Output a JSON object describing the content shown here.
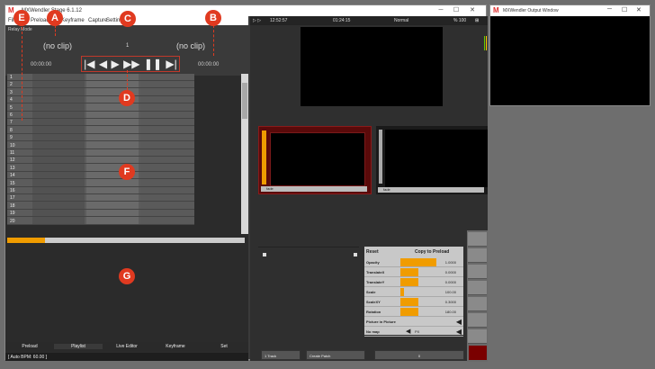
{
  "main_window": {
    "title": "MXWendler Stage 6.1.12"
  },
  "menu": [
    "File",
    "Preload",
    "Keyframe",
    "Capture",
    "Settings"
  ],
  "left": {
    "mode_label": "Relay Mode",
    "clip_left": "(no clip)",
    "clip_number": "1",
    "clip_right": "(no clip)",
    "time_left": "00:00:00",
    "time_right": "00:00:00",
    "transport": [
      "|◀",
      "◀",
      "▶",
      "▶▶",
      "❚❚",
      "▶|"
    ],
    "rows": [
      "1",
      "2",
      "3",
      "4",
      "5",
      "6",
      "7",
      "8",
      "9",
      "10",
      "11",
      "12",
      "13",
      "14",
      "15",
      "16",
      "17",
      "18",
      "19",
      "20"
    ],
    "tabs": [
      "Preload",
      "Playlist",
      "Live Editor",
      "Keyframe",
      "Set"
    ],
    "status": "[ Auto BPM: 60.00 ]"
  },
  "right": {
    "time_current": "12:52:57",
    "time_elapsed": "01:24:15",
    "blend_mode": "Normal",
    "opacity_pct": "% 100",
    "layer1_label": "fade",
    "layer2_label": "fade",
    "props": {
      "reset": "Reset",
      "copy": "Copy to Preload",
      "rows": [
        {
          "label": "Opacity",
          "value": "1.0000",
          "fill": 1.0
        },
        {
          "label": "TranslateX",
          "value": "0.0000",
          "fill": 0.5
        },
        {
          "label": "TranslateY",
          "value": "0.0000",
          "fill": 0.5
        },
        {
          "label": "Scale",
          "value": "100.00",
          "fill": 0.1
        },
        {
          "label": "ScaleXY",
          "value": "0.3000",
          "fill": 0.5
        },
        {
          "label": "Rotation",
          "value": "180.00",
          "fill": 0.5
        }
      ],
      "pip": "Picture in Picture",
      "no_map_label": "No map",
      "no_map_value": "PX"
    },
    "footer": {
      "track": "1 Track",
      "create_patch": "Create Patch",
      "value": "0"
    }
  },
  "output_window": {
    "title": "MXWendler Output Window"
  },
  "callouts": [
    "A",
    "B",
    "C",
    "D",
    "E",
    "F",
    "G"
  ],
  "colors": {
    "accent": "#f09c00",
    "callout": "#e03a20",
    "layer_active": "#5a0a0a"
  }
}
